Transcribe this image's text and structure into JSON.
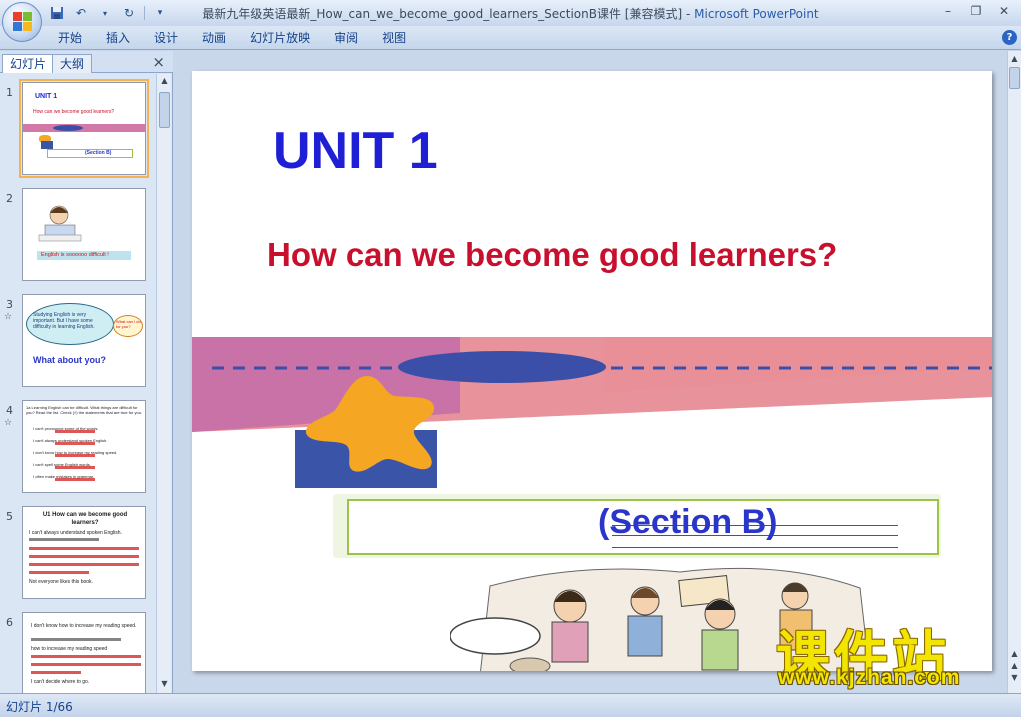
{
  "window": {
    "title": "最新九年级英语最新_How_can_we_become_good_learners_SectionB课件 [兼容模式] - ",
    "app_name": "Microsoft PowerPoint"
  },
  "ribbon": {
    "tabs": [
      "开始",
      "插入",
      "设计",
      "动画",
      "幻灯片放映",
      "审阅",
      "视图"
    ]
  },
  "left_pane": {
    "tab_slides": "幻灯片",
    "tab_outline": "大纲",
    "close": "×",
    "thumbnails": [
      {
        "number": "1",
        "lines": [
          "UNIT 1",
          "How can we become good learners?",
          "(Section B)"
        ]
      },
      {
        "number": "2",
        "lines": [
          "English is soooooo difficult !"
        ]
      },
      {
        "number": "3",
        "lines": [
          "Studying English is very important. But I have some difficulty in learning English.",
          "What can I do for you?",
          "What about you?"
        ]
      },
      {
        "number": "4",
        "lines": [
          "1a Learning English can be difficult. What things are difficult for you? Read the list. Check (√) the statements that are true for you.",
          "I can't pronounce some of the words.",
          "I can't always understand spoken English.",
          "I don't know how to increase my reading speed.",
          "I can't spell some English words.",
          "I often make mistakes in grammar."
        ]
      },
      {
        "number": "5",
        "lines": [
          "U1 How can we become good learners?",
          "I can't always understand spoken English.",
          "Not everyone likes this book."
        ]
      },
      {
        "number": "6",
        "lines": [
          "I don't know how to increase my reading speed.",
          "how to increase my reading speed",
          "I can't decide where to go."
        ]
      }
    ]
  },
  "slide": {
    "unit": "UNIT 1",
    "question": "How can we become good learners?",
    "section": "(Section  B)"
  },
  "watermark": {
    "cn": "课件站",
    "url": "www.kjzhan.com"
  },
  "status": {
    "text": "幻灯片 1/66"
  },
  "colors": {
    "unit_blue": "#1f1fd6",
    "question_red": "#c8102e",
    "section_blue": "#2a36c9",
    "band_purple": "#c873a6",
    "band_pink": "#ea8f9c",
    "ellipse_blue": "#3c4fa8",
    "star_orange": "#f5a623",
    "rect_blue": "#3a55a8",
    "frame_green": "#9bc34a",
    "watermark_yellow": "#f2e600"
  }
}
